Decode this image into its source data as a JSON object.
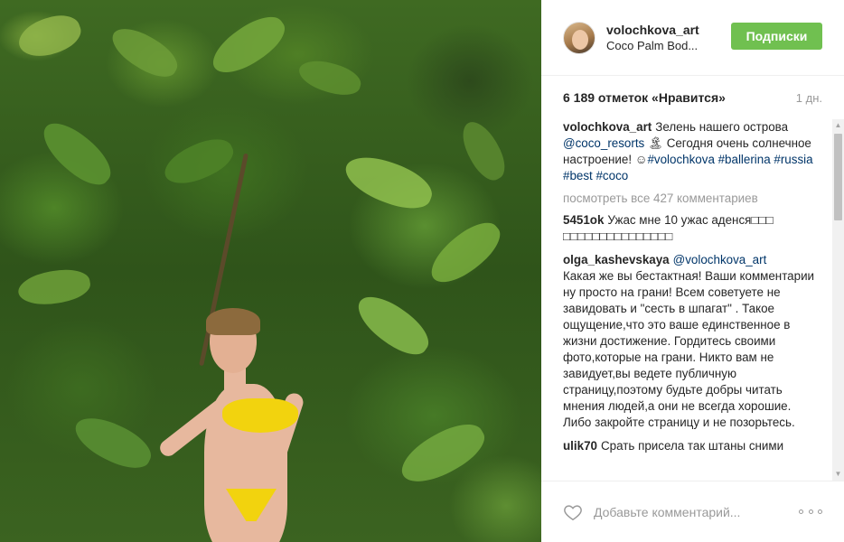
{
  "post": {
    "username": "volochkova_art",
    "location": "Coco Palm Bod...",
    "follow_label": "Подписки",
    "likes": "6 189 отметок «Нравится»",
    "time": "1 дн."
  },
  "caption": {
    "user": "volochkova_art",
    "text_before": "Зелень нашего острова ",
    "mention": "@coco_resorts",
    "text_after": " 🏝 Сегодня очень солнечное настроение! ☺",
    "hashtags": "#volochkova #ballerina #russia #best #coco"
  },
  "view_all": "посмотреть все 427 комментариев",
  "comments": [
    {
      "user": "5451ok",
      "mention": "",
      "text": "Ужас мне 10 ужас аденся□□□ □□□□□□□□□□□□□□□"
    },
    {
      "user": "olga_kashevskaya",
      "mention": "@volochkova_art",
      "text": "Какая же вы бестактная! Ваши комментарии ну просто на грани! Всем советуете не завидовать и \"сесть в шпагат\" . Такое ощущение,что это ваше единственное в жизни достижение. Гордитесь своими фото,которые на грани. Никто вам не завидует,вы ведете публичную страницу,поэтому будьте добры читать мнения людей,а они не всегда хорошие. Либо закройте страницу и не позорьтесь."
    },
    {
      "user": "ulik70",
      "mention": "",
      "text": "Срать присела так штаны сними"
    }
  ],
  "footer": {
    "comment_placeholder": "Добавьте комментарий..."
  },
  "icons": {
    "heart": "heart-icon",
    "more": "more-options-icon"
  },
  "colors": {
    "follow_button": "#70c050",
    "link": "#003569",
    "muted": "#999999"
  }
}
